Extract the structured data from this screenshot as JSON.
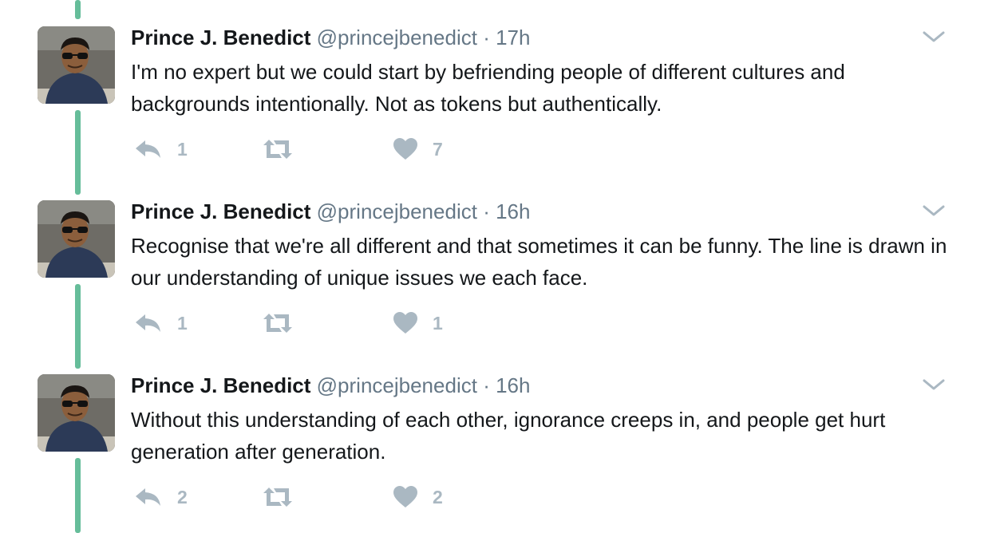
{
  "colors": {
    "thread_line": "#66bd9a",
    "icon_gray": "#aab8c2",
    "secondary_text": "#657786",
    "primary_text": "#14171a"
  },
  "icons": {
    "reply": "reply-icon",
    "retweet": "retweet-icon",
    "like": "heart-icon",
    "menu": "chevron-down-icon"
  },
  "tweets": [
    {
      "name": "Prince J. Benedict",
      "handle": "@princejbenedict",
      "separator": "·",
      "time": "17h",
      "text": "I'm no expert but we could start by befriending people of different cultures and backgrounds intentionally. Not as tokens but authentically.",
      "replies": "1",
      "retweets": "",
      "likes": "7"
    },
    {
      "name": "Prince J. Benedict",
      "handle": "@princejbenedict",
      "separator": "·",
      "time": "16h",
      "text": "Recognise that we're all different and that sometimes it can be funny. The line is drawn in our understanding of unique issues we each face.",
      "replies": "1",
      "retweets": "",
      "likes": "1"
    },
    {
      "name": "Prince J. Benedict",
      "handle": "@princejbenedict",
      "separator": "·",
      "time": "16h",
      "text": "Without this understanding of each other, ignorance creeps in, and people get hurt generation after generation.",
      "replies": "2",
      "retweets": "",
      "likes": "2"
    }
  ]
}
